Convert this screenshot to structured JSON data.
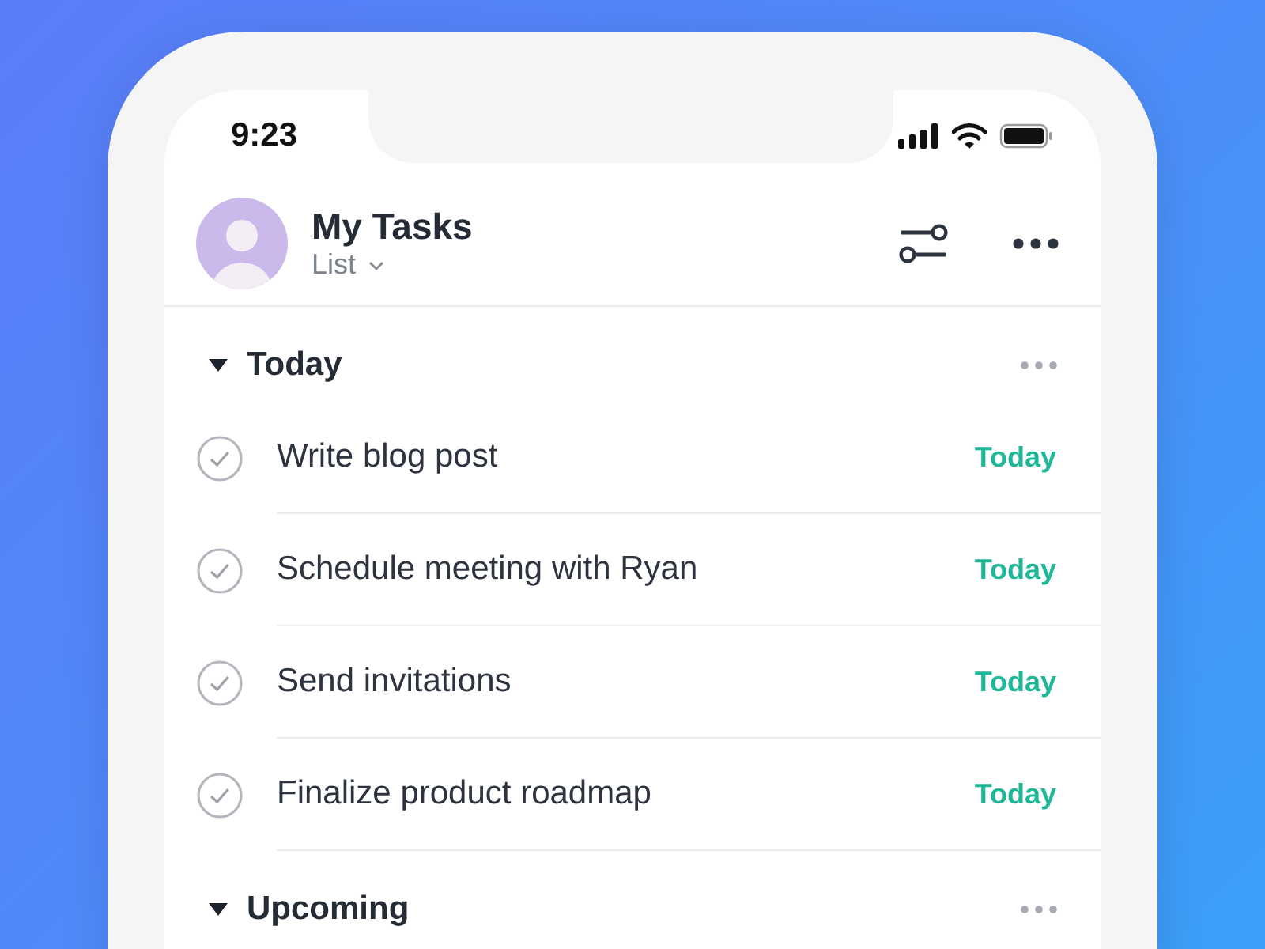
{
  "status_bar": {
    "time": "9:23"
  },
  "header": {
    "title": "My Tasks",
    "view": "List"
  },
  "sections": [
    {
      "title": "Today",
      "expanded": true,
      "tasks": [
        {
          "name": "Write blog post",
          "due": "Today",
          "completed": false
        },
        {
          "name": "Schedule meeting with Ryan",
          "due": "Today",
          "completed": false
        },
        {
          "name": "Send invitations",
          "due": "Today",
          "completed": false
        },
        {
          "name": "Finalize product roadmap",
          "due": "Today",
          "completed": false
        }
      ]
    },
    {
      "title": "Upcoming",
      "expanded": true
    }
  ]
}
